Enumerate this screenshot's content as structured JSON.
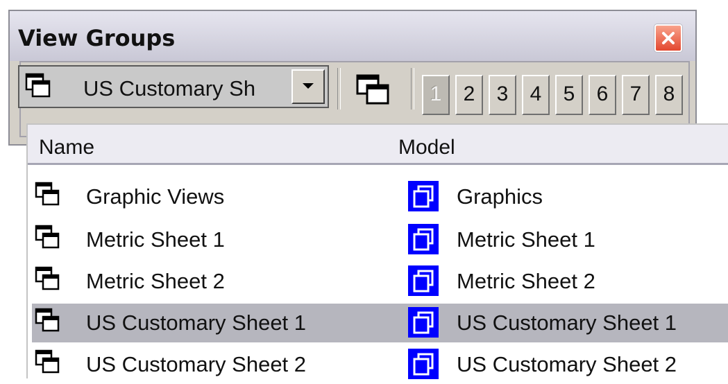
{
  "window": {
    "title": "View Groups",
    "close_icon": "close-icon"
  },
  "toolbar": {
    "combo_value": "US Customary Sh",
    "combo_icon": "view-group-icon",
    "dropdown_icon": "chevron-down-icon",
    "view_button_icon": "view-group-icon",
    "numbers": [
      "1",
      "2",
      "3",
      "4",
      "5",
      "6",
      "7",
      "8"
    ],
    "disabled_number": "1"
  },
  "list": {
    "headers": {
      "name": "Name",
      "model": "Model"
    },
    "rows": [
      {
        "name": "Graphic Views",
        "model": "Graphics",
        "selected": false
      },
      {
        "name": "Metric Sheet 1",
        "model": "Metric Sheet 1",
        "selected": false
      },
      {
        "name": "Metric Sheet 2",
        "model": "Metric Sheet 2",
        "selected": false
      },
      {
        "name": "US Customary Sheet 1",
        "model": "US Customary Sheet 1",
        "selected": true
      },
      {
        "name": "US Customary Sheet 2",
        "model": "US Customary Sheet 2",
        "selected": false
      }
    ]
  },
  "colors": {
    "selected_row": "#b6b6be",
    "model_icon_blue": "#0000ff",
    "close_red": "#e3472f"
  }
}
